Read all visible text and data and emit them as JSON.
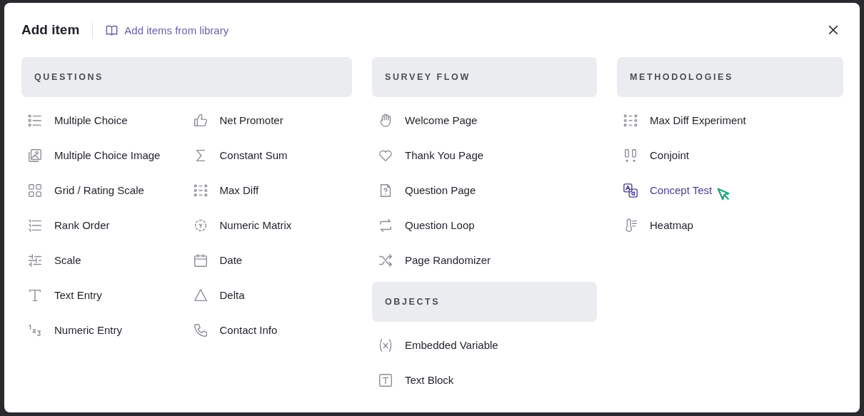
{
  "dialog": {
    "title": "Add item",
    "library_link": "Add items from library"
  },
  "columns": [
    {
      "sections": [
        {
          "title": "QUESTIONS",
          "item_columns": [
            [
              {
                "label": "Multiple Choice",
                "highlighted": false
              },
              {
                "label": "Multiple Choice Image",
                "highlighted": false
              },
              {
                "label": "Grid / Rating Scale",
                "highlighted": false
              },
              {
                "label": "Rank Order",
                "highlighted": false
              },
              {
                "label": "Scale",
                "highlighted": false
              },
              {
                "label": "Text Entry",
                "highlighted": false
              },
              {
                "label": "Numeric Entry",
                "highlighted": false
              }
            ],
            [
              {
                "label": "Net Promoter",
                "highlighted": false
              },
              {
                "label": "Constant Sum",
                "highlighted": false
              },
              {
                "label": "Max Diff",
                "highlighted": false
              },
              {
                "label": "Numeric Matrix",
                "highlighted": false
              },
              {
                "label": "Date",
                "highlighted": false
              },
              {
                "label": "Delta",
                "highlighted": false
              },
              {
                "label": "Contact Info",
                "highlighted": false
              }
            ]
          ]
        }
      ]
    },
    {
      "sections": [
        {
          "title": "SURVEY FLOW",
          "item_columns": [
            [
              {
                "label": "Welcome Page",
                "highlighted": false
              },
              {
                "label": "Thank You Page",
                "highlighted": false
              },
              {
                "label": "Question Page",
                "highlighted": false
              },
              {
                "label": "Question Loop",
                "highlighted": false
              },
              {
                "label": "Page Randomizer",
                "highlighted": false
              }
            ]
          ]
        },
        {
          "title": "OBJECTS",
          "item_columns": [
            [
              {
                "label": "Embedded Variable",
                "highlighted": false
              },
              {
                "label": "Text Block",
                "highlighted": false
              }
            ]
          ]
        }
      ]
    },
    {
      "sections": [
        {
          "title": "METHODOLOGIES",
          "item_columns": [
            [
              {
                "label": "Max Diff Experiment",
                "highlighted": false
              },
              {
                "label": "Conjoint",
                "highlighted": false
              },
              {
                "label": "Concept Test",
                "highlighted": true
              },
              {
                "label": "Heatmap",
                "highlighted": false
              }
            ]
          ]
        }
      ]
    }
  ]
}
